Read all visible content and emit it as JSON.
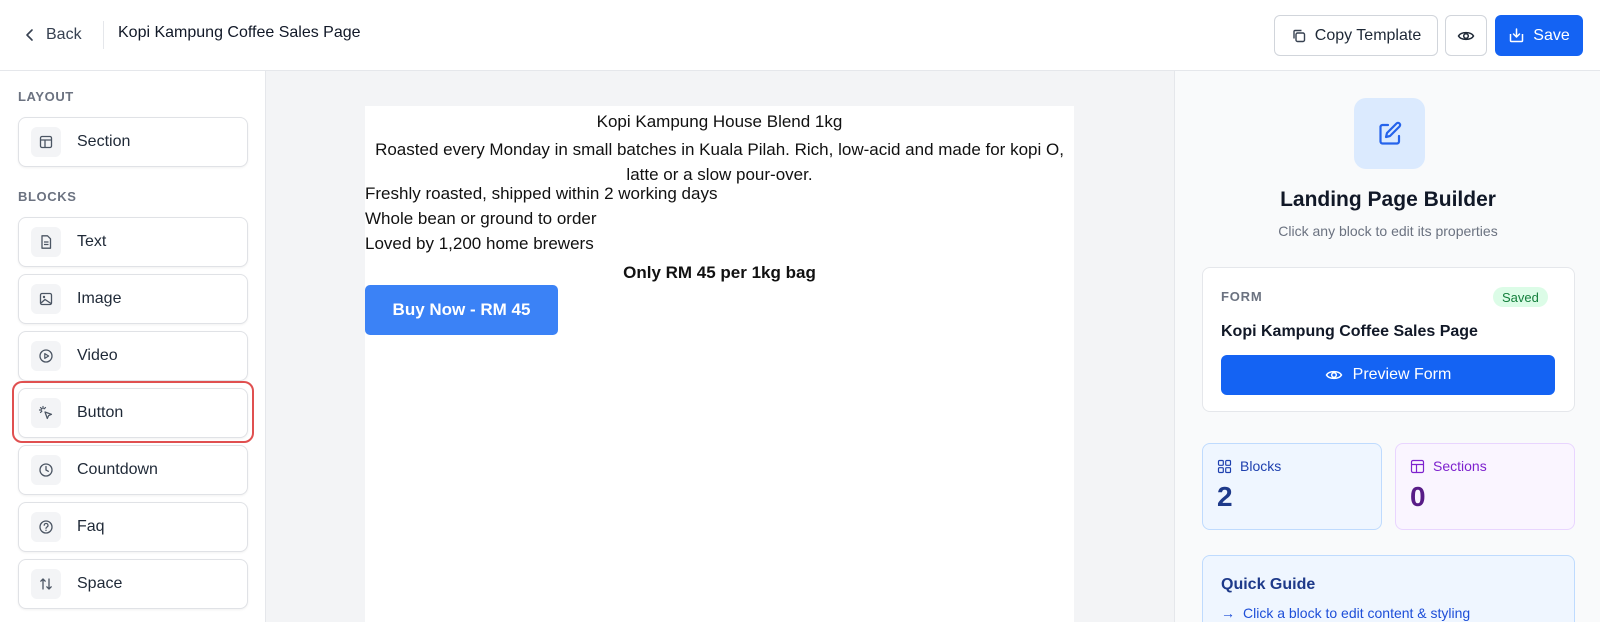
{
  "header": {
    "back_label": "Back",
    "page_title": "Kopi Kampung Coffee Sales Page",
    "copy_template_label": "Copy Template",
    "save_label": "Save"
  },
  "sidebar": {
    "layout_label": "LAYOUT",
    "blocks_label": "BLOCKS",
    "layout_items": [
      {
        "label": "Section",
        "icon": "section-icon"
      }
    ],
    "block_items": [
      {
        "label": "Text",
        "icon": "text-icon"
      },
      {
        "label": "Image",
        "icon": "image-icon"
      },
      {
        "label": "Video",
        "icon": "video-icon"
      },
      {
        "label": "Button",
        "icon": "pointer-click-icon",
        "selected": true
      },
      {
        "label": "Countdown",
        "icon": "clock-icon"
      },
      {
        "label": "Faq",
        "icon": "question-icon"
      },
      {
        "label": "Space",
        "icon": "arrows-updown-icon"
      }
    ],
    "highlight_color": "#e05050"
  },
  "canvas": {
    "title": "Kopi Kampung House Blend 1kg",
    "description": "Roasted every Monday in small batches in Kuala Pilah. Rich, low-acid and made for kopi O, latte or a slow pour-over.",
    "features": [
      "Freshly roasted, shipped within 2 working days",
      "Whole bean or ground to order",
      "Loved by 1,200 home brewers"
    ],
    "price_text": "Only RM 45 per 1kg bag",
    "buy_button_label": "Buy Now - RM 45",
    "buy_button_color": "#3b82f6"
  },
  "panel": {
    "title": "Landing Page Builder",
    "subtitle": "Click any block to edit its properties",
    "form": {
      "label": "FORM",
      "status": "Saved",
      "name": "Kopi Kampung Coffee Sales Page",
      "preview_label": "Preview Form"
    },
    "stats": {
      "blocks_label": "Blocks",
      "blocks_value": "2",
      "sections_label": "Sections",
      "sections_value": "0"
    },
    "guide": {
      "title": "Quick Guide",
      "items": [
        "Click a block to edit content & styling"
      ]
    }
  },
  "colors": {
    "primary": "#1463f3",
    "highlight": "#e05050"
  }
}
